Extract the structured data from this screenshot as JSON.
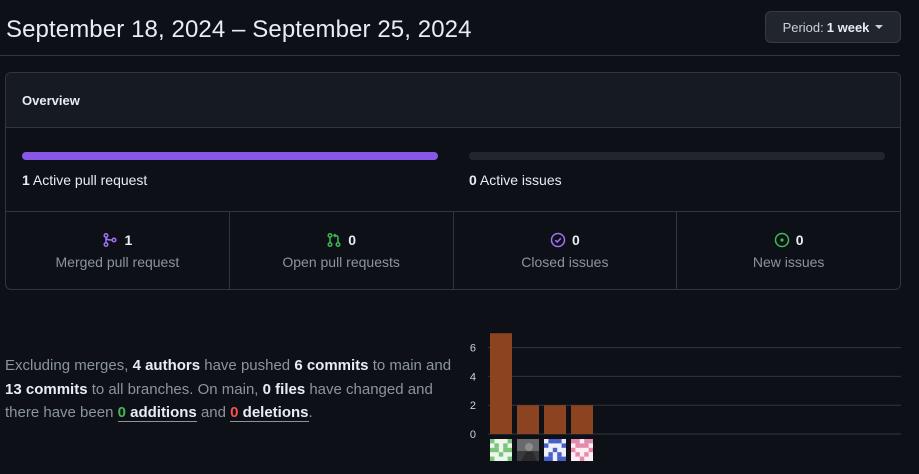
{
  "header": {
    "title": "September 18, 2024 – September 25, 2024",
    "period_prefix": "Period:",
    "period_value": "1 week"
  },
  "overview": {
    "title": "Overview",
    "pull_requests": {
      "count": "1",
      "text": "Active pull request",
      "fill_fraction": 1.0,
      "color": "#8957e5"
    },
    "issues": {
      "count": "0",
      "text": "Active issues",
      "fill_fraction": 0.0
    },
    "stats": [
      {
        "value": "1",
        "label": "Merged pull request",
        "icon": "git-merge-icon",
        "color": "#a371f7"
      },
      {
        "value": "0",
        "label": "Open pull requests",
        "icon": "git-pull-request-icon",
        "color": "#3fb950"
      },
      {
        "value": "0",
        "label": "Closed issues",
        "icon": "issue-closed-icon",
        "color": "#a371f7"
      },
      {
        "value": "0",
        "label": "New issues",
        "icon": "issue-opened-icon",
        "color": "#3fb950"
      }
    ]
  },
  "summary": {
    "t1": "Excluding merges, ",
    "authors": "4 authors",
    "t2": " have pushed ",
    "commits_main": "6 commits",
    "t3": " to main and ",
    "commits_all": "13 commits",
    "t4": " to all branches. On main, ",
    "files": "0 files",
    "t5": " have changed and there have been ",
    "additions_num": "0",
    "additions_word": " additions",
    "t6": " and ",
    "deletions_num": "0",
    "deletions_word": " deletions",
    "t7": "."
  },
  "chart_data": {
    "type": "bar",
    "categories": [
      "author-1",
      "author-2",
      "author-3",
      "author-4"
    ],
    "values": [
      7,
      2,
      2,
      2
    ],
    "yticks": [
      0,
      2,
      4,
      6
    ],
    "ylim": [
      0,
      7
    ],
    "bar_color": "#8b4320",
    "grid": true
  }
}
